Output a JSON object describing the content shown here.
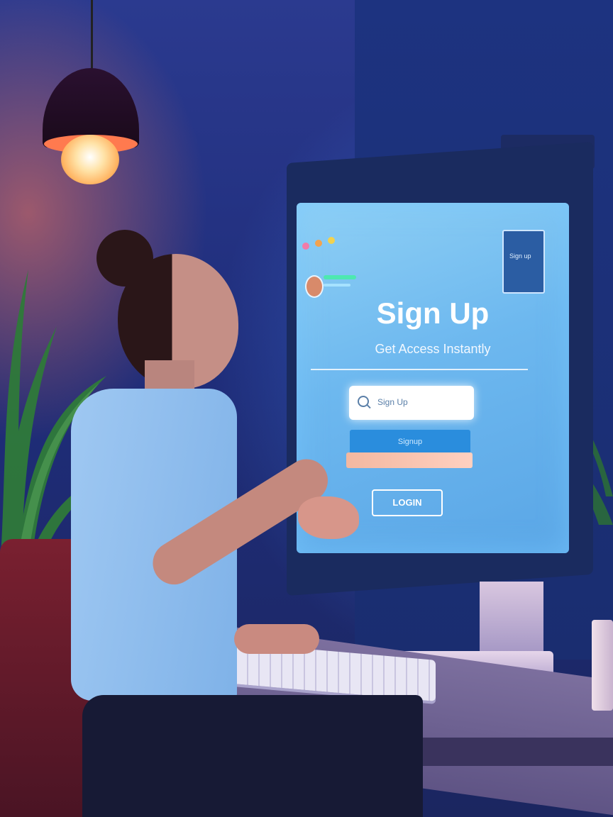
{
  "screen": {
    "window_dots": [
      "#f27ba8",
      "#f2a34f",
      "#f2d24f"
    ],
    "badge_label": "Sign up",
    "title": "Sign Up",
    "subtitle": "Get Access Instantly",
    "input": {
      "placeholder": "Sign Up"
    },
    "primary_button_label": "Signup",
    "secondary_button_label": "LOGIN"
  },
  "colors": {
    "wall": "#1f2d7a",
    "screen_glow": "#6db8ef",
    "lamp_light": "#ffd59a",
    "primary_button": "#2a8ddd"
  }
}
